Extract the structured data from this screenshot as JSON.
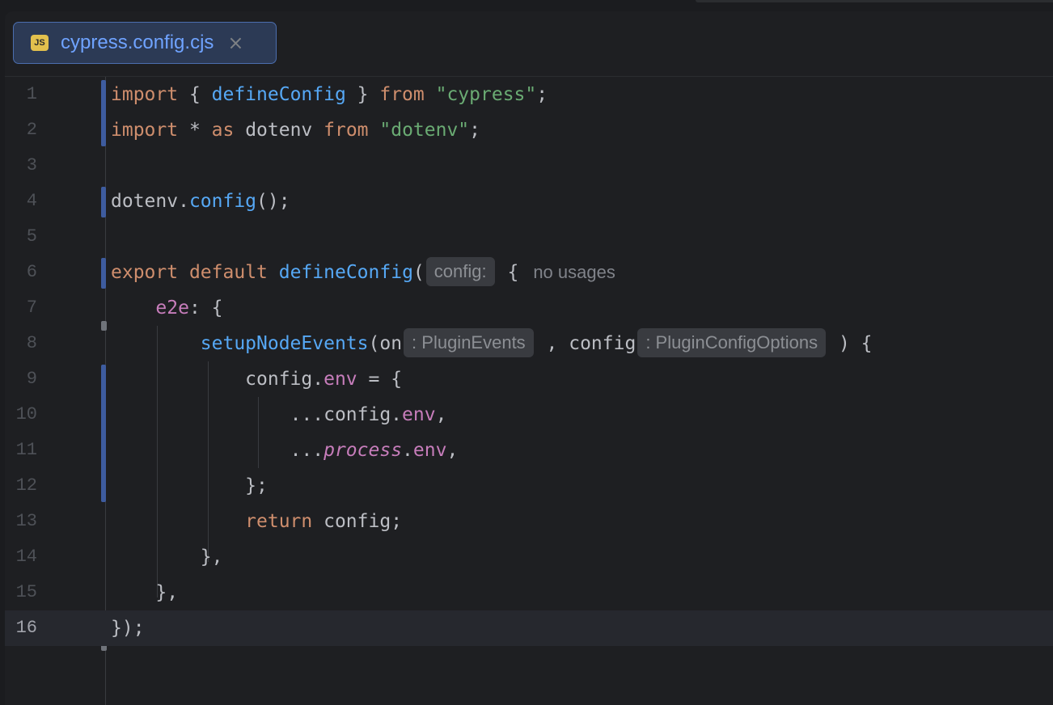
{
  "tab": {
    "icon_label": "JS",
    "title": "cypress.config.cjs",
    "close_glyph": "×"
  },
  "line_numbers": [
    "1",
    "2",
    "3",
    "4",
    "5",
    "6",
    "7",
    "8",
    "9",
    "10",
    "11",
    "12",
    "13",
    "14",
    "15",
    "16"
  ],
  "code": {
    "l1": {
      "kw1": "import",
      "t1": " { ",
      "fn1": "defineConfig",
      "t2": " } ",
      "kw2": "from",
      "t3": " ",
      "str1": "\"cypress\"",
      "t4": ";"
    },
    "l2": {
      "kw1": "import",
      "t1": " * ",
      "kw2": "as",
      "t2": " dotenv ",
      "kw3": "from",
      "t3": " ",
      "str1": "\"dotenv\"",
      "t4": ";"
    },
    "l4": {
      "t1": "dotenv.",
      "fn1": "config",
      "t2": "();"
    },
    "l6": {
      "kw1": "export",
      "t1": " ",
      "kw2": "default",
      "t2": " ",
      "fn1": "defineConfig",
      "t3": "(",
      "hint": "config:",
      "t4": " {",
      "usages": "no usages"
    },
    "l7": {
      "indent": "    ",
      "prop1": "e2e",
      "t1": ": {"
    },
    "l8": {
      "indent": "        ",
      "fn1": "setupNodeEvents",
      "t1": "(on",
      "hint1": ": PluginEvents",
      "t2": " , config",
      "hint2": ": PluginConfigOptions",
      "t3": " ) {"
    },
    "l9": {
      "indent": "            ",
      "t1": "config.",
      "prop1": "env",
      "t2": " = {"
    },
    "l10": {
      "indent": "                ",
      "t1": "...config.",
      "prop1": "env",
      "t2": ","
    },
    "l11": {
      "indent": "                ",
      "t1": "...",
      "ital1": "process",
      "t2": ".",
      "prop1": "env",
      "t3": ","
    },
    "l12": {
      "indent": "            ",
      "t1": "};"
    },
    "l13": {
      "indent": "            ",
      "kw1": "return",
      "t1": " config;"
    },
    "l14": {
      "indent": "        ",
      "t1": "},"
    },
    "l15": {
      "indent": "    ",
      "t1": "},"
    },
    "l16": {
      "t1": "});"
    }
  },
  "colors": {
    "keyword": "#cf8e6d",
    "function": "#56a8f5",
    "string": "#6aab73",
    "property": "#c77dbb",
    "text": "#bcbec4",
    "change_marker": "#3e5c9f",
    "tab_accent": "#4b6eaf"
  }
}
